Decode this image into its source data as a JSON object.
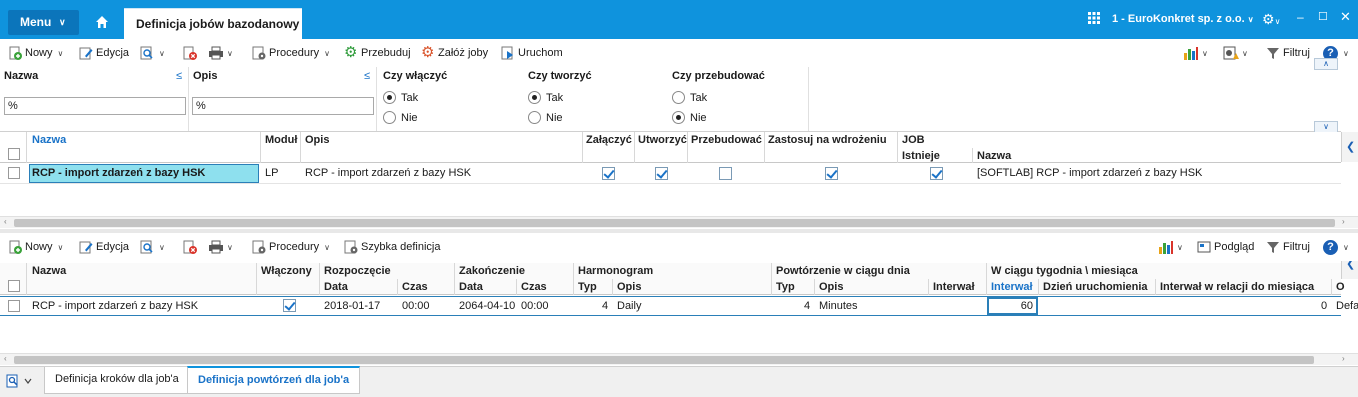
{
  "titlebar": {
    "menu_label": "Menu",
    "tab_title": "Definicja jobów bazodanowy",
    "company": "1 - EuroKonkret sp. z o.o."
  },
  "toolbar1": {
    "new": "Nowy",
    "edit": "Edycja",
    "procedures": "Procedury",
    "rebuild": "Przebuduj",
    "create_jobs": "Załóż joby",
    "run": "Uruchom",
    "filter": "Filtruj"
  },
  "filter": {
    "name_label": "Nazwa",
    "name_value": "%",
    "desc_label": "Opis",
    "desc_value": "%",
    "enable_label": "Czy włączyć",
    "create_label": "Czy tworzyć",
    "rebuild_label": "Czy przebudować",
    "yes": "Tak",
    "no": "Nie"
  },
  "grid1": {
    "headers": {
      "name": "Nazwa",
      "module": "Moduł",
      "desc": "Opis",
      "attach": "Załączyć",
      "create": "Utworzyć",
      "rebuild": "Przebudować",
      "apply": "Zastosuj na wdrożeniu",
      "job": "JOB",
      "exists": "Istnieje",
      "job_name": "Nazwa"
    },
    "row": {
      "name": "RCP - import zdarzeń z bazy HSK",
      "module": "LP",
      "desc": "RCP - import zdarzeń z bazy HSK",
      "job_name": "[SOFTLAB] RCP - import zdarzeń z bazy HSK",
      "attach": true,
      "create": true,
      "rebuild": false,
      "apply": true,
      "exists": true
    }
  },
  "toolbar2": {
    "new": "Nowy",
    "edit": "Edycja",
    "procedures": "Procedury",
    "quick_def": "Szybka definicja",
    "preview": "Podgląd",
    "filter": "Filtruj"
  },
  "grid2": {
    "headers": {
      "name": "Nazwa",
      "enabled": "Włączony",
      "start": "Rozpoczęcie",
      "end": "Zakończenie",
      "schedule": "Harmonogram",
      "repeat": "Powtórzenie w ciągu dnia",
      "week": "W ciągu tygodnia \\ miesiąca",
      "date": "Data",
      "time": "Czas",
      "type": "Typ",
      "desc": "Opis",
      "interval": "Interwał",
      "interval_blue": "Interwał",
      "run_day": "Dzień uruchomienia",
      "interval_month": "Interwał w relacji do miesiąca",
      "o": "O"
    },
    "row": {
      "name": "RCP - import zdarzeń z bazy HSK",
      "enabled": true,
      "start_date": "2018-01-17",
      "start_time": "00:00",
      "end_date": "2064-04-10",
      "end_time": "00:00",
      "sched_type": "4",
      "sched_desc": "Daily",
      "rep_type": "4",
      "rep_desc": "Minutes",
      "interval": "60",
      "interval_month": "0",
      "defa": "Defa"
    }
  },
  "bottom_tabs": {
    "tab1": "Definicja kroków dla job'a",
    "tab2": "Definicja powtórzeń dla job'a"
  },
  "colors": {
    "accent": "#0f93dd",
    "selected_row": "#8ee0ee"
  }
}
